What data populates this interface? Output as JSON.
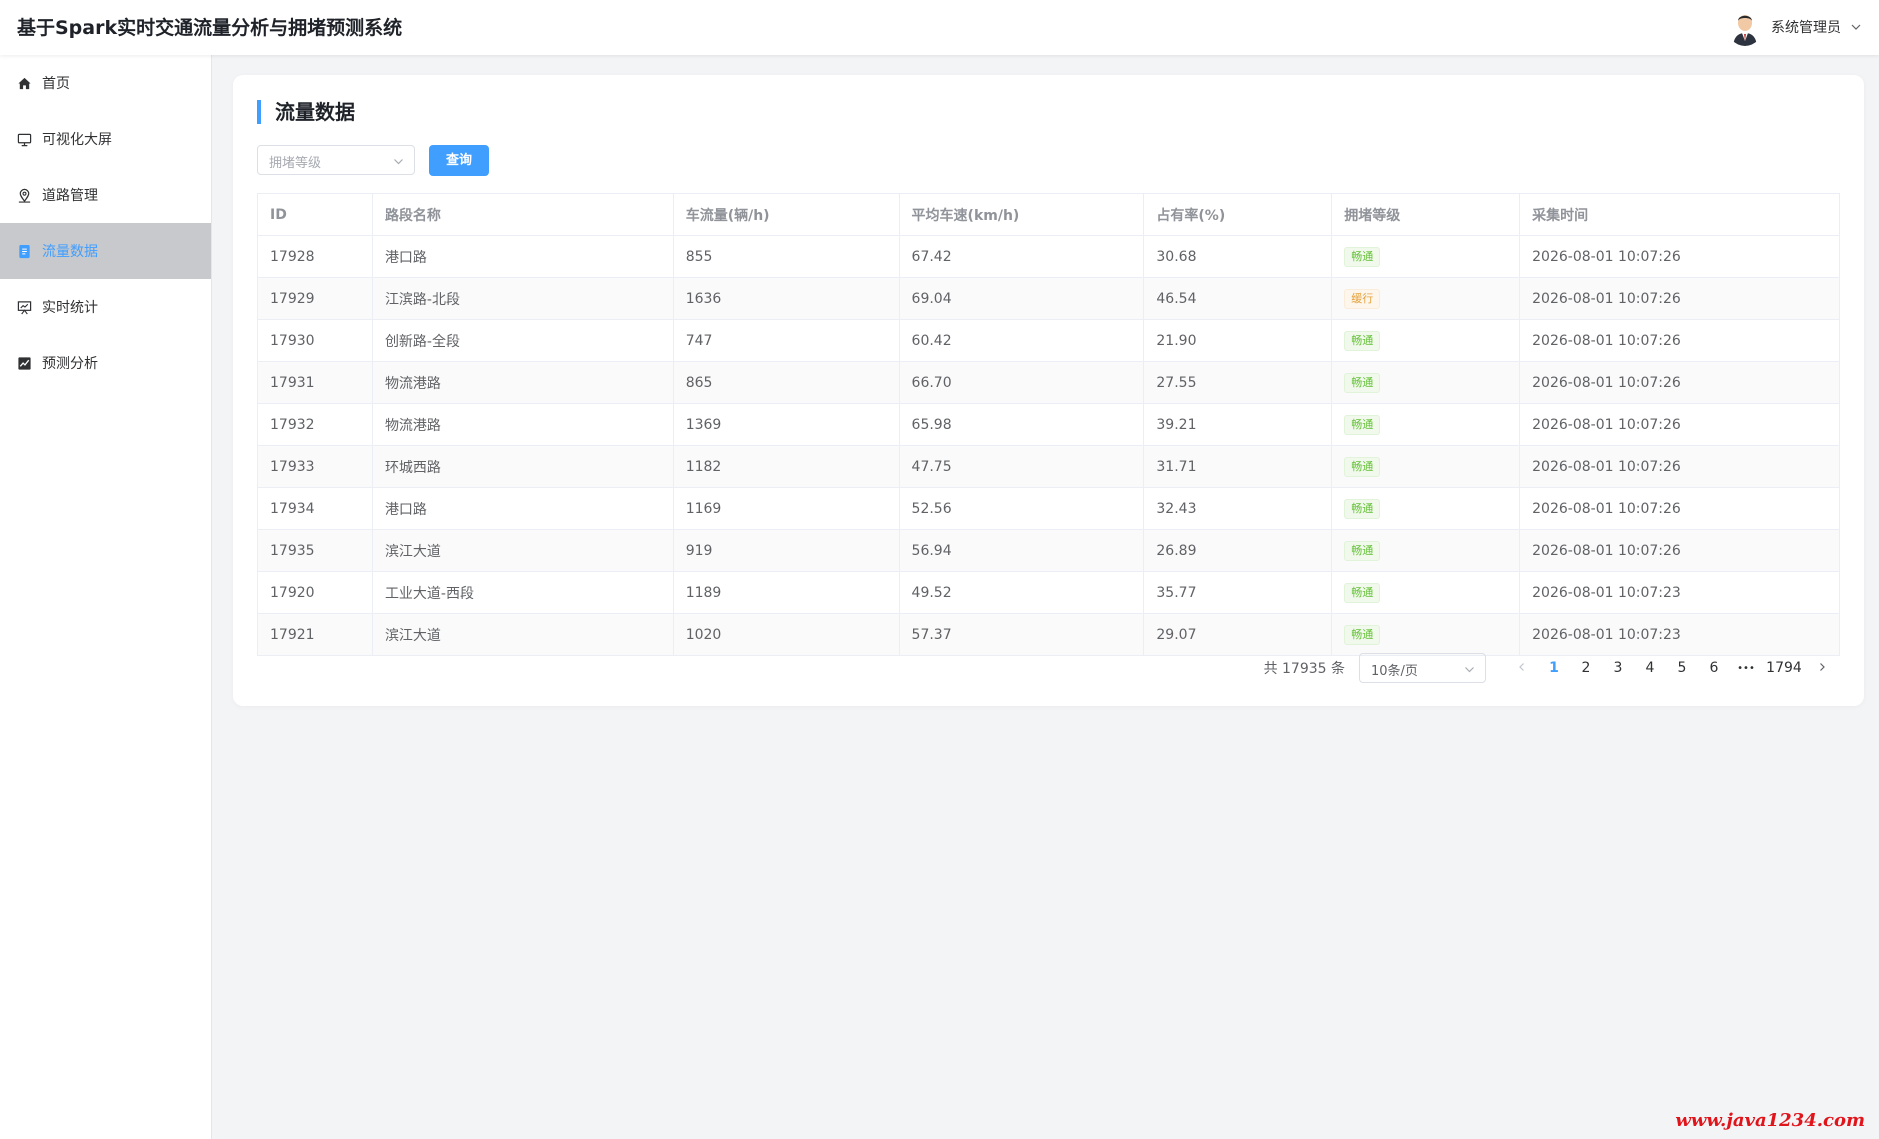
{
  "app": {
    "title": "基于Spark实时交通流量分析与拥堵预测系统"
  },
  "user": {
    "name": "系统管理员"
  },
  "sidebar": {
    "items": [
      {
        "label": "首页",
        "icon": "home-icon",
        "active": false
      },
      {
        "label": "可视化大屏",
        "icon": "monitor-icon",
        "active": false
      },
      {
        "label": "道路管理",
        "icon": "location-icon",
        "active": false
      },
      {
        "label": "流量数据",
        "icon": "document-icon",
        "active": true
      },
      {
        "label": "实时统计",
        "icon": "presentation-icon",
        "active": false
      },
      {
        "label": "预测分析",
        "icon": "trend-chart-icon",
        "active": false
      }
    ]
  },
  "page": {
    "title": "流量数据"
  },
  "filter": {
    "placeholder": "拥堵等级",
    "query_label": "查询"
  },
  "table": {
    "headers": [
      "ID",
      "路段名称",
      "车流量(辆/h)",
      "平均车速(km/h)",
      "占有率(%)",
      "拥堵等级",
      "采集时间"
    ],
    "rows": [
      {
        "id": "17928",
        "road": "港口路",
        "flow": "855",
        "speed": "67.42",
        "occupancy": "30.68",
        "level": "畅通",
        "time": "2026-08-01 10:07:26"
      },
      {
        "id": "17929",
        "road": "江滨路-北段",
        "flow": "1636",
        "speed": "69.04",
        "occupancy": "46.54",
        "level": "缓行",
        "time": "2026-08-01 10:07:26"
      },
      {
        "id": "17930",
        "road": "创新路-全段",
        "flow": "747",
        "speed": "60.42",
        "occupancy": "21.90",
        "level": "畅通",
        "time": "2026-08-01 10:07:26"
      },
      {
        "id": "17931",
        "road": "物流港路",
        "flow": "865",
        "speed": "66.70",
        "occupancy": "27.55",
        "level": "畅通",
        "time": "2026-08-01 10:07:26"
      },
      {
        "id": "17932",
        "road": "物流港路",
        "flow": "1369",
        "speed": "65.98",
        "occupancy": "39.21",
        "level": "畅通",
        "time": "2026-08-01 10:07:26"
      },
      {
        "id": "17933",
        "road": "环城西路",
        "flow": "1182",
        "speed": "47.75",
        "occupancy": "31.71",
        "level": "畅通",
        "time": "2026-08-01 10:07:26"
      },
      {
        "id": "17934",
        "road": "港口路",
        "flow": "1169",
        "speed": "52.56",
        "occupancy": "32.43",
        "level": "畅通",
        "time": "2026-08-01 10:07:26"
      },
      {
        "id": "17935",
        "road": "滨江大道",
        "flow": "919",
        "speed": "56.94",
        "occupancy": "26.89",
        "level": "畅通",
        "time": "2026-08-01 10:07:26"
      },
      {
        "id": "17920",
        "road": "工业大道-西段",
        "flow": "1189",
        "speed": "49.52",
        "occupancy": "35.77",
        "level": "畅通",
        "time": "2026-08-01 10:07:23"
      },
      {
        "id": "17921",
        "road": "滨江大道",
        "flow": "1020",
        "speed": "57.37",
        "occupancy": "29.07",
        "level": "畅通",
        "time": "2026-08-01 10:07:23"
      }
    ]
  },
  "pagination": {
    "total_text": "共 17935 条",
    "page_size": "10条/页",
    "pages": [
      "1",
      "2",
      "3",
      "4",
      "5",
      "6"
    ],
    "current": "1",
    "ellipsis": "•••",
    "last_page": "1794"
  },
  "watermark": "www.java1234.com",
  "colors": {
    "accent": "#409eff",
    "ok": "#67c23a",
    "slow": "#e6a23c"
  }
}
